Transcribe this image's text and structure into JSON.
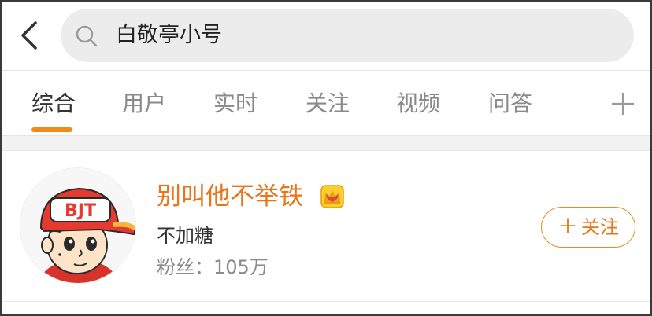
{
  "search": {
    "query": "白敬亭小号"
  },
  "tabs": [
    {
      "label": "综合"
    },
    {
      "label": "用户"
    },
    {
      "label": "实时"
    },
    {
      "label": "关注"
    },
    {
      "label": "视频"
    },
    {
      "label": "问答"
    }
  ],
  "active_tab": "综合",
  "user_card": {
    "name": "别叫他不举铁",
    "description": "不加糖",
    "fans": "粉丝：105万",
    "follow_label": "关注",
    "avatar_text": "BJT"
  },
  "colors": {
    "accent": "#eb7418",
    "tab_indicator": "#f08a18"
  },
  "icons": {
    "back": "chevron-left",
    "search": "magnifier",
    "add_tab": "plus",
    "vip": "crown-badge"
  }
}
